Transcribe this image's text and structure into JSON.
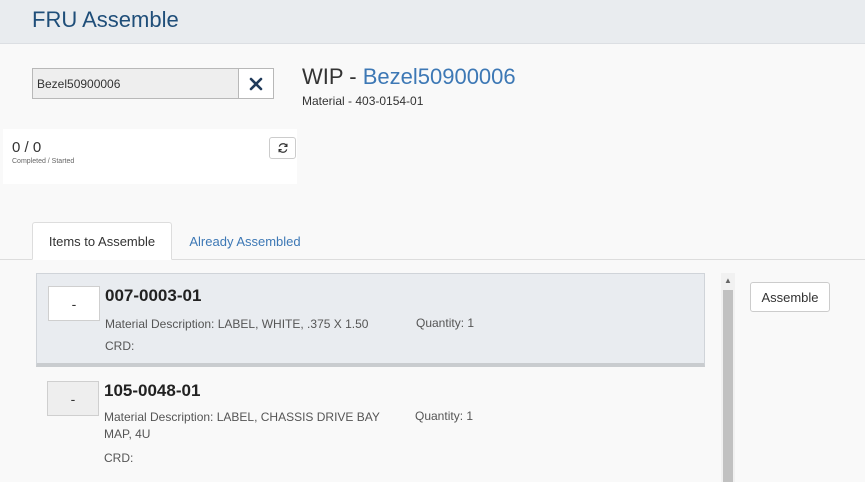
{
  "header": {
    "title": "FRU Assemble"
  },
  "search": {
    "value": "Bezel50900006"
  },
  "wip": {
    "prefix": "WIP - ",
    "id": "Bezel50900006",
    "material": "Material - 403-0154-01"
  },
  "counter": {
    "value": "0 / 0",
    "label": "Completed / Started"
  },
  "tabs": [
    {
      "label": "Items to Assemble",
      "active": true
    },
    {
      "label": "Already Assembled",
      "active": false
    }
  ],
  "items": [
    {
      "qty_box": "-",
      "part_no": "007-0003-01",
      "description": "Material Description: LABEL, WHITE, .375 X 1.50",
      "quantity": "Quantity: 1",
      "crd": "CRD:"
    },
    {
      "qty_box": "-",
      "part_no": "105-0048-01",
      "description": "Material Description: LABEL, CHASSIS DRIVE BAY MAP, 4U",
      "quantity": "Quantity: 1",
      "crd": "CRD:"
    }
  ],
  "actions": {
    "assemble_label": "Assemble"
  },
  "icons": {
    "clear": "close-icon",
    "refresh": "refresh-icon",
    "scroll_up": "arrow-up-icon"
  },
  "colors": {
    "accent": "#3d78b5",
    "header_title": "#1f4e79",
    "header_bg": "#e9ecef"
  }
}
